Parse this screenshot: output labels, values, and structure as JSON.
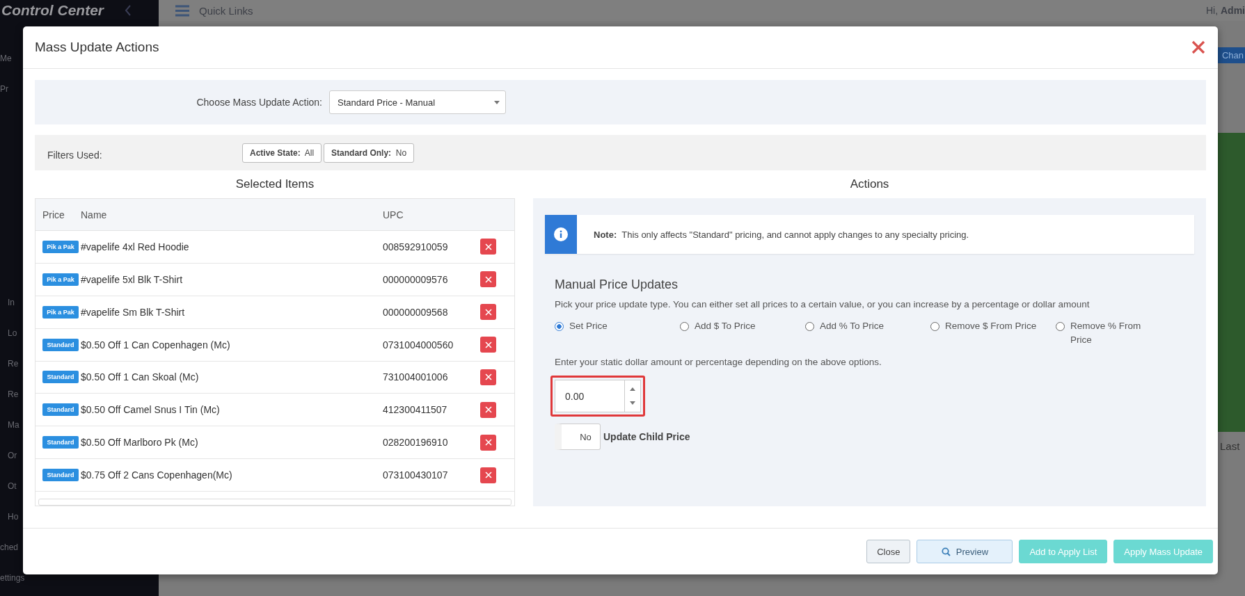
{
  "app": {
    "brand": "Control Center",
    "quick_links": "Quick Links",
    "greeting": "Hi,",
    "user": "Admi",
    "sidebar_groups": [
      [
        "Me",
        "Pr"
      ],
      [
        "In",
        "Lo",
        "Re",
        "Re",
        "Ma",
        "Or",
        "Ot",
        "Ho",
        "ched",
        "ettings"
      ]
    ],
    "edge_button": "Chan",
    "edge_text": "Last"
  },
  "modal": {
    "title": "Mass Update Actions",
    "action": {
      "label": "Choose Mass Update Action:",
      "value": "Standard Price - Manual"
    },
    "filters": {
      "label": "Filters Used:",
      "chips": [
        {
          "name": "Active State:",
          "value": "All"
        },
        {
          "name": "Standard Only:",
          "value": "No"
        }
      ]
    },
    "selected_items": {
      "title": "Selected Items",
      "columns": [
        "Price",
        "Name",
        "UPC"
      ],
      "rows": [
        {
          "price_tag": "Pik a Pak",
          "name": "#vapelife 4xl Red Hoodie",
          "upc": "008592910059"
        },
        {
          "price_tag": "Pik a Pak",
          "name": "#vapelife 5xl Blk T-Shirt",
          "upc": "000000009576"
        },
        {
          "price_tag": "Pik a Pak",
          "name": "#vapelife Sm Blk T-Shirt",
          "upc": "000000009568"
        },
        {
          "price_tag": "Standard",
          "name": "$0.50 Off 1 Can Copenhagen (Mc)",
          "upc": "0731004000560"
        },
        {
          "price_tag": "Standard",
          "name": "$0.50 Off 1 Can Skoal (Mc)",
          "upc": "731004001006"
        },
        {
          "price_tag": "Standard",
          "name": "$0.50 Off Camel Snus I Tin (Mc)",
          "upc": "412300411507"
        },
        {
          "price_tag": "Standard",
          "name": "$0.50 Off Marlboro Pk (Mc)",
          "upc": "028200196910"
        },
        {
          "price_tag": "Standard",
          "name": "$0.75 Off 2 Cans Copenhagen(Mc)",
          "upc": "073100430107"
        }
      ]
    },
    "actions": {
      "title": "Actions",
      "note_label": "Note:",
      "note": "This only affects \"Standard\" pricing, and cannot apply changes to any specialty pricing.",
      "heading": "Manual Price Updates",
      "description": "Pick your price update type. You can either set all prices to a certain value, or you can increase by a percentage or dollar amount",
      "options": [
        {
          "label": "Set Price",
          "selected": true
        },
        {
          "label": "Add $ To Price",
          "selected": false
        },
        {
          "label": "Add % To Price",
          "selected": false
        },
        {
          "label": "Remove $ From Price",
          "selected": false
        },
        {
          "label": "Remove % From Price",
          "selected": false
        }
      ],
      "amount_hint": "Enter your static dollar amount or percentage depending on the above options.",
      "amount": {
        "value": "0.00",
        "highlighted": true
      },
      "child_price": {
        "state": "No",
        "label": "Update Child Price",
        "on": false
      }
    },
    "buttons": [
      {
        "label": "Close",
        "kind": "default"
      },
      {
        "label": "Preview",
        "kind": "preview"
      },
      {
        "label": "Add to Apply List",
        "kind": "primary"
      },
      {
        "label": "Apply Mass Update",
        "kind": "primary"
      }
    ]
  }
}
